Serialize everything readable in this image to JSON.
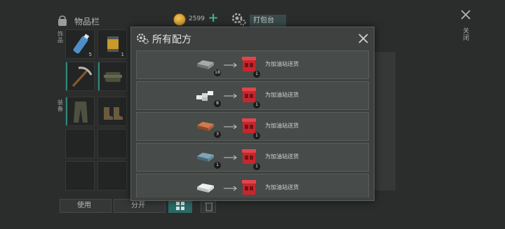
{
  "inventory": {
    "title": "物品栏",
    "coins": "2599",
    "pack_button": "打包台",
    "close_label": "关闭",
    "side_tab_1": "饰品",
    "side_tab_2": "装备",
    "slots": [
      {
        "icon": "water-bottle-icon",
        "count": "5"
      },
      {
        "icon": "filter-icon",
        "count": "1"
      },
      {
        "icon": "pickaxe-icon",
        "count": ""
      },
      {
        "icon": "backpack-icon",
        "count": ""
      },
      {
        "icon": "pants-icon",
        "count": ""
      },
      {
        "icon": "boots-icon",
        "count": ""
      }
    ],
    "use_button": "使用",
    "split_button": "分开"
  },
  "dialog": {
    "title": "所有配方",
    "recipes": [
      {
        "ingredient_icon": "iron-bar-icon",
        "ingredient_count": "18",
        "product_icon": "gas-station-icon",
        "product_count": "1",
        "label": "为加油站送货"
      },
      {
        "ingredient_icon": "silver-blocks-icon",
        "ingredient_count": "8",
        "product_icon": "gas-station-icon",
        "product_count": "1",
        "label": "为加油站送货"
      },
      {
        "ingredient_icon": "copper-bar-icon",
        "ingredient_count": "3",
        "product_icon": "gas-station-icon",
        "product_count": "1",
        "label": "为加油站送货"
      },
      {
        "ingredient_icon": "steel-bar-icon",
        "ingredient_count": "1",
        "product_icon": "gas-station-icon",
        "product_count": "1",
        "label": "为加油站送货"
      },
      {
        "ingredient_icon": "white-bar-icon",
        "ingredient_count": "",
        "product_icon": "gas-station-icon",
        "product_count": "",
        "label": "为加油站送货"
      }
    ]
  },
  "colors": {
    "accent": "#2c8a7a",
    "product_red": "#c8262c"
  }
}
